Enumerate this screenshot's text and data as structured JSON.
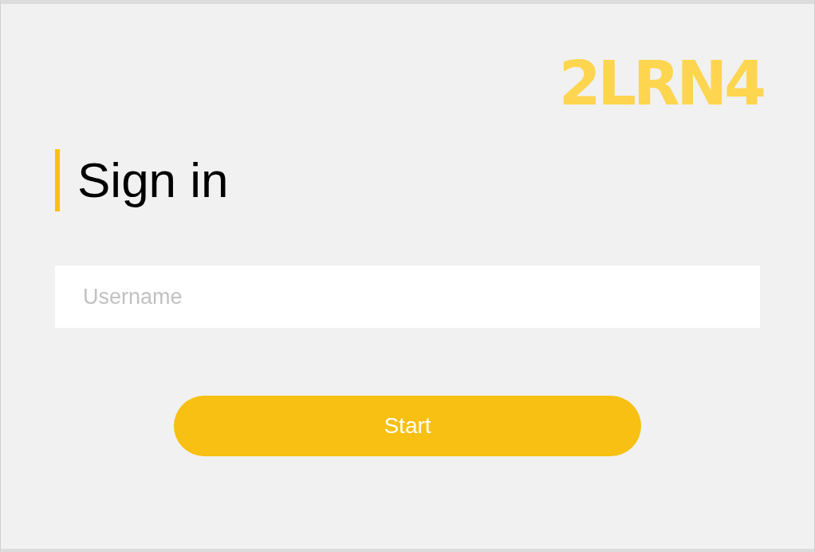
{
  "logo": {
    "text": "2LRN4"
  },
  "heading": {
    "title": "Sign in"
  },
  "username": {
    "placeholder": "Username"
  },
  "button": {
    "label": "Start"
  }
}
